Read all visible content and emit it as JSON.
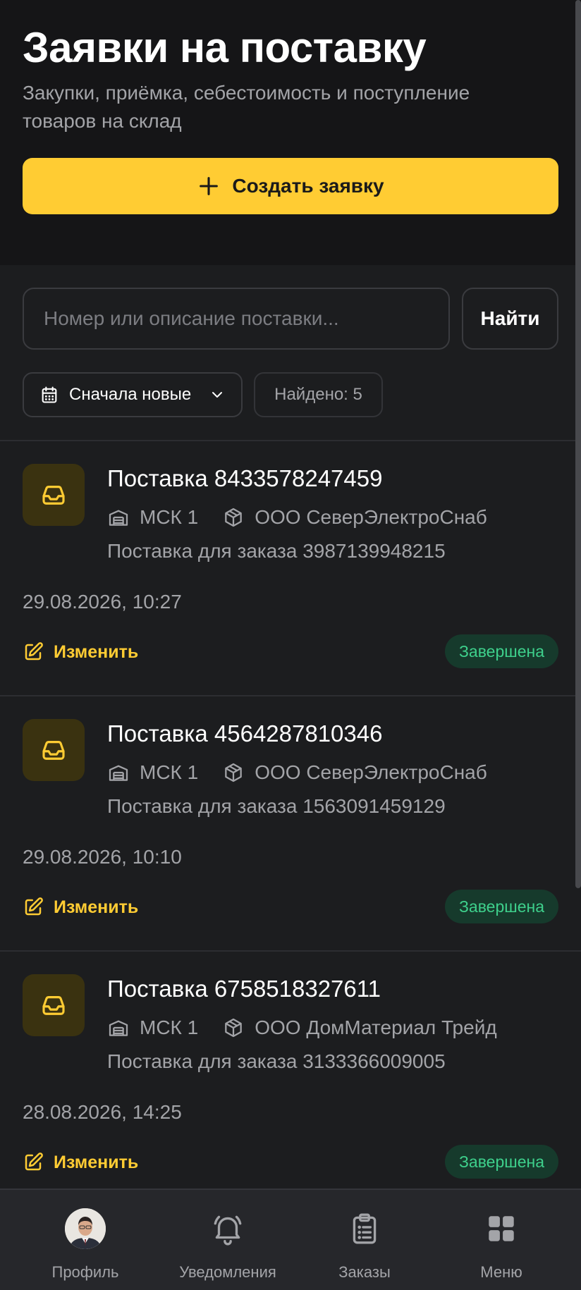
{
  "header": {
    "title": "Заявки на поставку",
    "subtitle": "Закупки, приёмка, себестоимость и поступление товаров на склад",
    "create_label": "Создать заявку"
  },
  "search": {
    "placeholder": "Номер или описание поставки...",
    "value": "",
    "button_label": "Найти"
  },
  "filters": {
    "sort_label": "Сначала новые",
    "found_label": "Найдено: 5"
  },
  "supplies": [
    {
      "title": "Поставка 8433578247459",
      "warehouse": "МСК 1",
      "supplier": "ООО СеверЭлектроСнаб",
      "description": "Поставка для заказа 3987139948215",
      "date": "29.08.2026, 10:27",
      "edit_label": "Изменить",
      "status": "Завершена"
    },
    {
      "title": "Поставка 4564287810346",
      "warehouse": "МСК 1",
      "supplier": "ООО СеверЭлектроСнаб",
      "description": "Поставка для заказа 1563091459129",
      "date": "29.08.2026, 10:10",
      "edit_label": "Изменить",
      "status": "Завершена"
    },
    {
      "title": "Поставка 6758518327611",
      "warehouse": "МСК 1",
      "supplier": "ООО ДомМатериал Трейд",
      "description": "Поставка для заказа 3133366009005",
      "date": "28.08.2026, 14:25",
      "edit_label": "Изменить",
      "status": "Завершена"
    }
  ],
  "nav": {
    "profile": "Профиль",
    "notifications": "Уведомления",
    "orders": "Заказы",
    "menu": "Меню"
  },
  "colors": {
    "accent": "#ffcc33",
    "background": "#1c1d1f",
    "header_background": "#151517",
    "status_text": "#3ed08c",
    "status_background": "#163a2c"
  },
  "icons": {
    "create": "plus-icon",
    "sort": "calendar-icon",
    "dropdown": "chevron-down-icon",
    "card": "inbox-tray-icon",
    "warehouse": "warehouse-icon",
    "supplier": "package-icon",
    "edit": "edit-icon",
    "nav": [
      "avatar",
      "bell-icon",
      "clipboard-icon",
      "grid-icon"
    ]
  }
}
